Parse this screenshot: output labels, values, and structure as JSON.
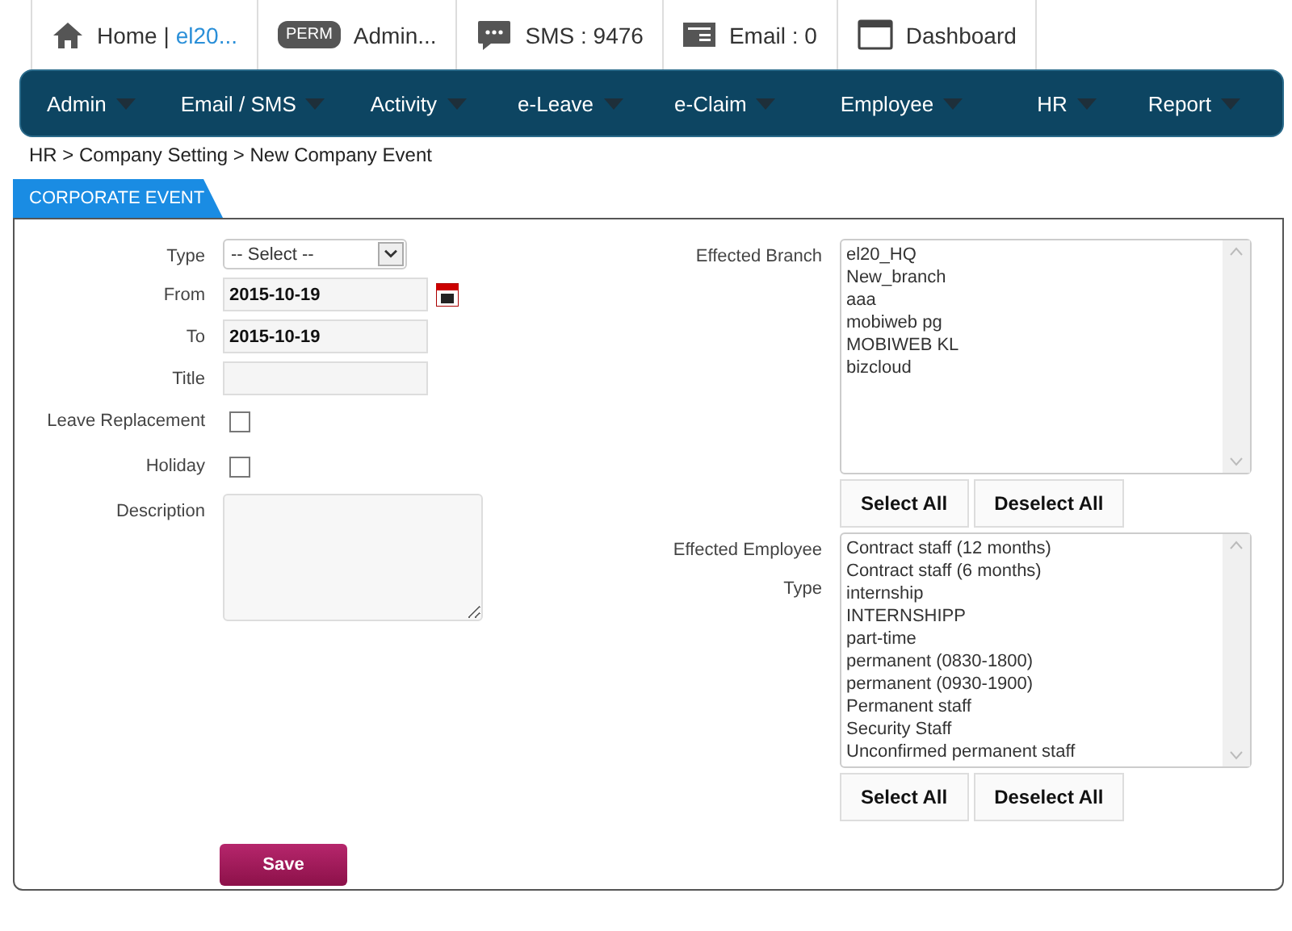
{
  "header": {
    "items": [
      {
        "kind": "home",
        "label": "Home |",
        "link": "el20..."
      },
      {
        "kind": "perm",
        "badge": "PERM",
        "label": "Admin..."
      },
      {
        "kind": "sms",
        "label": "SMS : 9476"
      },
      {
        "kind": "email",
        "label": "Email : 0"
      },
      {
        "kind": "dashboard",
        "label": "Dashboard"
      }
    ]
  },
  "menu": [
    "Admin",
    "Email / SMS",
    "Activity",
    "e-Leave",
    "e-Claim",
    "Employee",
    "HR",
    "Report"
  ],
  "breadcrumb": "HR > Company Setting > New Company Event",
  "tab": "CORPORATE EVENT",
  "form": {
    "type": {
      "label": "Type",
      "value": "-- Select --"
    },
    "from": {
      "label": "From",
      "value": "2015-10-19"
    },
    "to": {
      "label": "To",
      "value": "2015-10-19"
    },
    "title": {
      "label": "Title"
    },
    "checks": [
      {
        "label": "Leave Replacement",
        "checked": false
      },
      {
        "label": "Holiday",
        "checked": false
      }
    ],
    "description": {
      "label": "Description"
    }
  },
  "branch": {
    "label": "Effected Branch",
    "options": [
      "el20_HQ",
      "New_branch",
      "aaa",
      "mobiweb pg",
      "MOBIWEB KL",
      "bizcloud"
    ],
    "buttons": [
      "Select All",
      "Deselect All"
    ]
  },
  "employee_type": {
    "label_lines": [
      "Effected Employee",
      "Type"
    ],
    "options": [
      "Contract staff (12 months)",
      "Contract staff (6 months)",
      "internship",
      "INTERNSHIPP",
      "part-time",
      "permanent (0830-1800)",
      "permanent (0930-1900)",
      "Permanent staff",
      "Security Staff",
      "Unconfirmed permanent staff"
    ],
    "buttons": [
      "Select All",
      "Deselect All"
    ]
  },
  "save": "Save"
}
